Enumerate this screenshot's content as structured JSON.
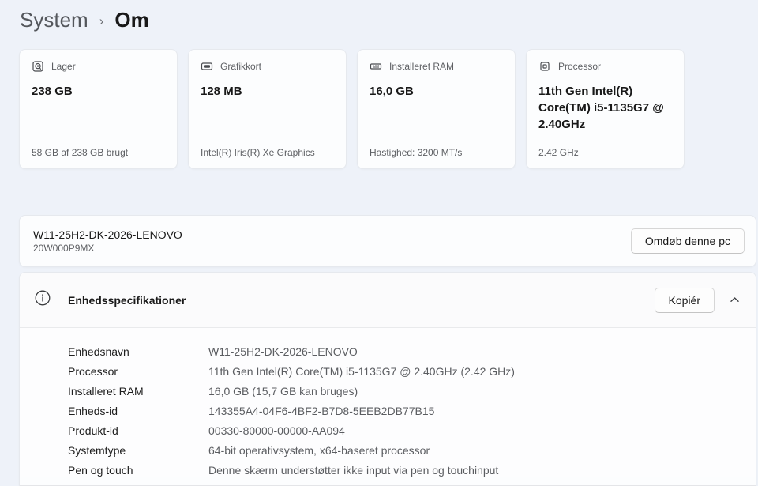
{
  "breadcrumb": {
    "parent": "System",
    "separator": "›",
    "current": "Om"
  },
  "cards": [
    {
      "icon": "storage-icon",
      "label": "Lager",
      "value": "238 GB",
      "footnote": "58 GB af 238 GB brugt"
    },
    {
      "icon": "gpu-icon",
      "label": "Grafikkort",
      "value": "128 MB",
      "footnote": "Intel(R) Iris(R) Xe Graphics"
    },
    {
      "icon": "ram-icon",
      "label": "Installeret RAM",
      "value": "16,0 GB",
      "footnote": "Hastighed: 3200 MT/s"
    },
    {
      "icon": "cpu-icon",
      "label": "Processor",
      "value": "11th Gen Intel(R) Core(TM) i5-1135G7 @ 2.40GHz",
      "footnote": "2.42 GHz"
    }
  ],
  "device": {
    "name": "W11-25H2-DK-2026-LENOVO",
    "model": "20W000P9MX",
    "rename_button": "Omdøb denne pc"
  },
  "specs": {
    "icon": "info-icon",
    "title": "Enhedsspecifikationer",
    "copy_button": "Kopiér",
    "expand_state_icon": "chevron-up-icon",
    "rows": [
      {
        "label": "Enhedsnavn",
        "value": "W11-25H2-DK-2026-LENOVO"
      },
      {
        "label": "Processor",
        "value": "11th Gen Intel(R) Core(TM) i5-1135G7 @ 2.40GHz (2.42 GHz)"
      },
      {
        "label": "Installeret RAM",
        "value": "16,0 GB (15,7 GB kan bruges)"
      },
      {
        "label": "Enheds-id",
        "value": "143355A4-04F6-4BF2-B7D8-5EEB2DB77B15"
      },
      {
        "label": "Produkt-id",
        "value": "00330-80000-00000-AA094"
      },
      {
        "label": "Systemtype",
        "value": "64-bit operativsystem, x64-baseret processor"
      },
      {
        "label": "Pen og touch",
        "value": "Denne skærm understøtter ikke input via pen og touchinput"
      }
    ]
  },
  "colors": {
    "page_background": "#eef2f9",
    "card_background": "#fcfdfe",
    "card_border": "#e6e9ee",
    "secondary_text": "#5d5f63",
    "primary_text": "#191919"
  }
}
